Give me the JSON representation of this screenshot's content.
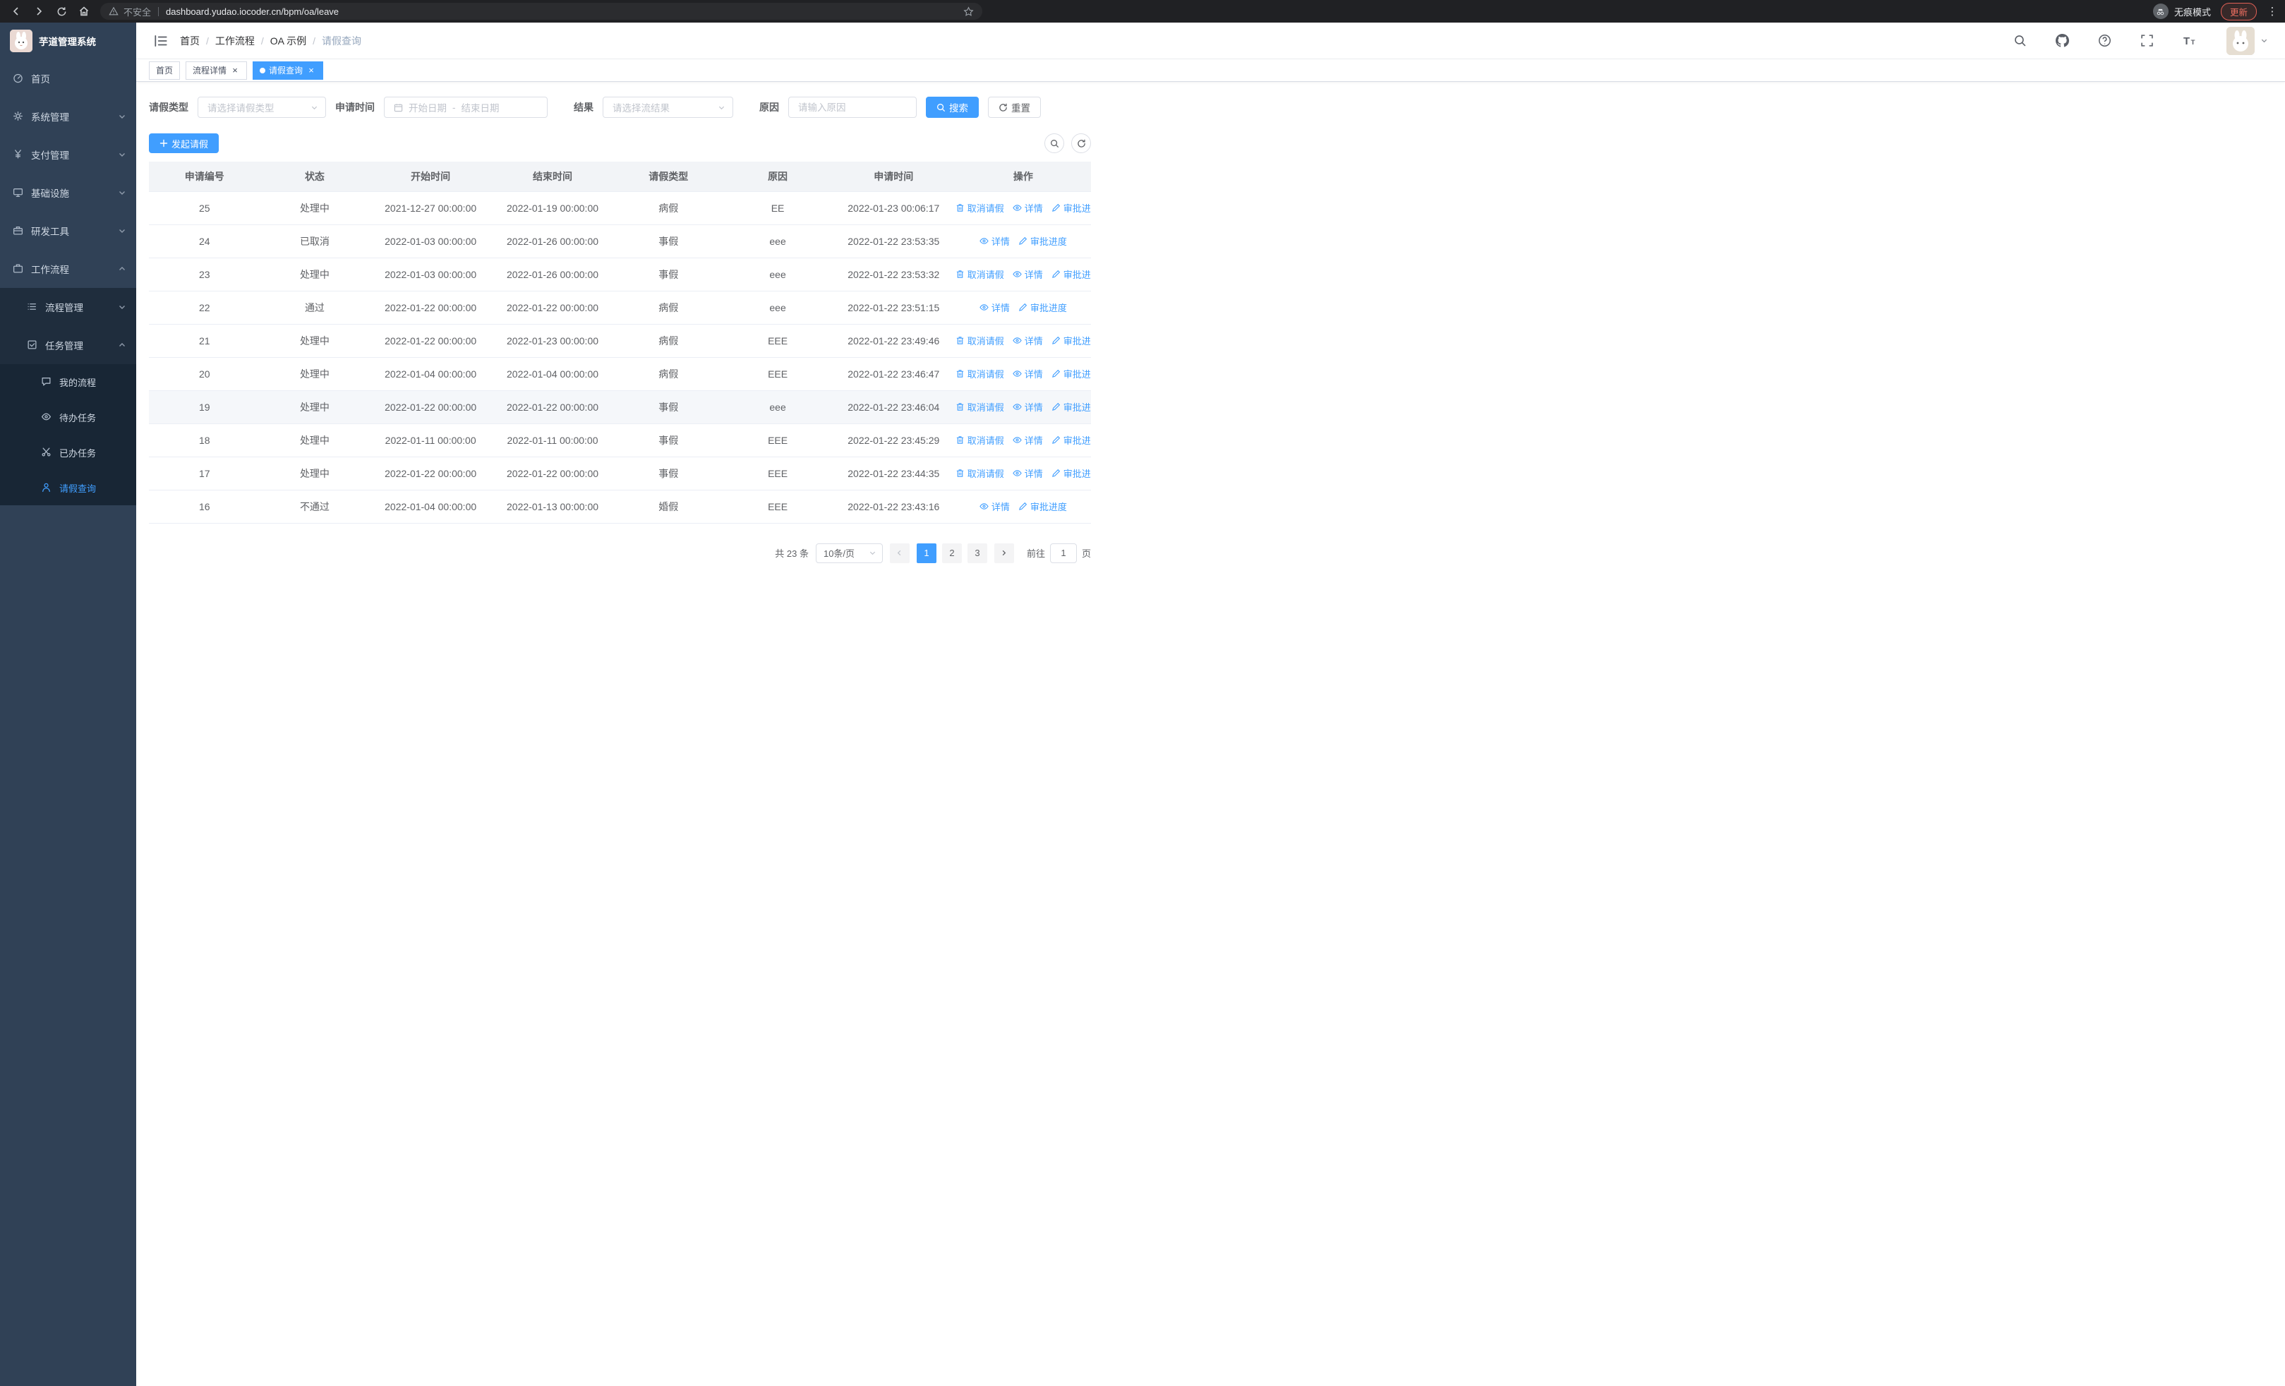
{
  "browser": {
    "security_label": "不安全",
    "url": "dashboard.yudao.iocoder.cn/bpm/oa/leave",
    "incognito_label": "无痕模式",
    "update_label": "更新"
  },
  "sidebar": {
    "logo_title": "芋道管理系统",
    "items": [
      {
        "label": "首页"
      },
      {
        "label": "系统管理"
      },
      {
        "label": "支付管理"
      },
      {
        "label": "基础设施"
      },
      {
        "label": "研发工具"
      },
      {
        "label": "工作流程"
      }
    ],
    "submenu": [
      {
        "label": "流程管理"
      },
      {
        "label": "任务管理"
      }
    ],
    "task_items": [
      {
        "label": "我的流程"
      },
      {
        "label": "待办任务"
      },
      {
        "label": "已办任务"
      },
      {
        "label": "请假查询"
      }
    ]
  },
  "header": {
    "breadcrumb": [
      "首页",
      "工作流程",
      "OA 示例",
      "请假查询"
    ]
  },
  "tabs": [
    {
      "label": "首页"
    },
    {
      "label": "流程详情"
    },
    {
      "label": "请假查询"
    }
  ],
  "filters": {
    "leave_type_label": "请假类型",
    "leave_type_placeholder": "请选择请假类型",
    "apply_time_label": "申请时间",
    "start_date_placeholder": "开始日期",
    "range_separator": "-",
    "end_date_placeholder": "结束日期",
    "result_label": "结果",
    "result_placeholder": "请选择流结果",
    "reason_label": "原因",
    "reason_placeholder": "请输入原因",
    "search_button": "搜索",
    "reset_button": "重置"
  },
  "toolbar": {
    "create_button": "发起请假"
  },
  "table": {
    "columns": [
      "申请编号",
      "状态",
      "开始时间",
      "结束时间",
      "请假类型",
      "原因",
      "申请时间",
      "操作"
    ],
    "actions": {
      "cancel": "取消请假",
      "detail": "详情",
      "progress": "审批进度"
    },
    "rows": [
      {
        "id": "25",
        "status": "处理中",
        "start": "2021-12-27 00:00:00",
        "end": "2022-01-19 00:00:00",
        "type": "病假",
        "reason": "EE",
        "applied": "2022-01-23 00:06:17",
        "cancellable": true,
        "hover": false
      },
      {
        "id": "24",
        "status": "已取消",
        "start": "2022-01-03 00:00:00",
        "end": "2022-01-26 00:00:00",
        "type": "事假",
        "reason": "eee",
        "applied": "2022-01-22 23:53:35",
        "cancellable": false,
        "hover": false
      },
      {
        "id": "23",
        "status": "处理中",
        "start": "2022-01-03 00:00:00",
        "end": "2022-01-26 00:00:00",
        "type": "事假",
        "reason": "eee",
        "applied": "2022-01-22 23:53:32",
        "cancellable": true,
        "hover": false
      },
      {
        "id": "22",
        "status": "通过",
        "start": "2022-01-22 00:00:00",
        "end": "2022-01-22 00:00:00",
        "type": "病假",
        "reason": "eee",
        "applied": "2022-01-22 23:51:15",
        "cancellable": false,
        "hover": false
      },
      {
        "id": "21",
        "status": "处理中",
        "start": "2022-01-22 00:00:00",
        "end": "2022-01-23 00:00:00",
        "type": "病假",
        "reason": "EEE",
        "applied": "2022-01-22 23:49:46",
        "cancellable": true,
        "hover": false
      },
      {
        "id": "20",
        "status": "处理中",
        "start": "2022-01-04 00:00:00",
        "end": "2022-01-04 00:00:00",
        "type": "病假",
        "reason": "EEE",
        "applied": "2022-01-22 23:46:47",
        "cancellable": true,
        "hover": false
      },
      {
        "id": "19",
        "status": "处理中",
        "start": "2022-01-22 00:00:00",
        "end": "2022-01-22 00:00:00",
        "type": "事假",
        "reason": "eee",
        "applied": "2022-01-22 23:46:04",
        "cancellable": true,
        "hover": true
      },
      {
        "id": "18",
        "status": "处理中",
        "start": "2022-01-11 00:00:00",
        "end": "2022-01-11 00:00:00",
        "type": "事假",
        "reason": "EEE",
        "applied": "2022-01-22 23:45:29",
        "cancellable": true,
        "hover": false
      },
      {
        "id": "17",
        "status": "处理中",
        "start": "2022-01-22 00:00:00",
        "end": "2022-01-22 00:00:00",
        "type": "事假",
        "reason": "EEE",
        "applied": "2022-01-22 23:44:35",
        "cancellable": true,
        "hover": false
      },
      {
        "id": "16",
        "status": "不通过",
        "start": "2022-01-04 00:00:00",
        "end": "2022-01-13 00:00:00",
        "type": "婚假",
        "reason": "EEE",
        "applied": "2022-01-22 23:43:16",
        "cancellable": false,
        "hover": false
      }
    ]
  },
  "pagination": {
    "total_label": "共 23 条",
    "page_size": "10条/页",
    "pages": [
      "1",
      "2",
      "3"
    ],
    "active_page": "1",
    "goto_label": "前往",
    "goto_value": "1",
    "page_suffix": "页"
  }
}
